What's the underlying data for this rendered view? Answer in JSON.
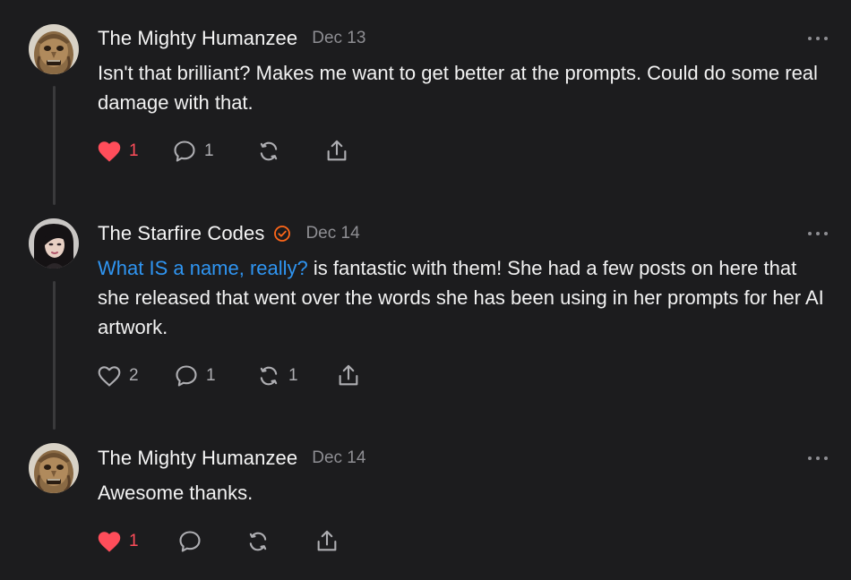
{
  "posts": [
    {
      "author": "The Mighty Humanzee",
      "date": "Dec 13",
      "body": "Isn't that brilliant? Makes me want to get better at the prompts. Could do some real damage with that.",
      "likes": "1",
      "liked": true,
      "comments": "1",
      "restacks": "",
      "avatar_icon": "statue-face-avatar"
    },
    {
      "author": "The Starfire Codes",
      "verified": true,
      "date": "Dec 14",
      "body_link": "What IS a name, really?",
      "body": " is fantastic with them! She had a few posts on here that she released that went over the words she has been using in her prompts for her AI artwork.",
      "likes": "2",
      "liked": false,
      "comments": "1",
      "restacks": "1",
      "avatar_icon": "woman-portrait-avatar"
    },
    {
      "author": "The Mighty Humanzee",
      "date": "Dec 14",
      "body": "Awesome thanks.",
      "likes": "1",
      "liked": true,
      "comments": "",
      "restacks": "",
      "avatar_icon": "statue-face-avatar"
    }
  ],
  "colors": {
    "background": "#1c1c1e",
    "like_active": "#ff4d5a",
    "link": "#2f95f2",
    "verified_badge": "#ff6719",
    "muted": "#8e8e93"
  }
}
